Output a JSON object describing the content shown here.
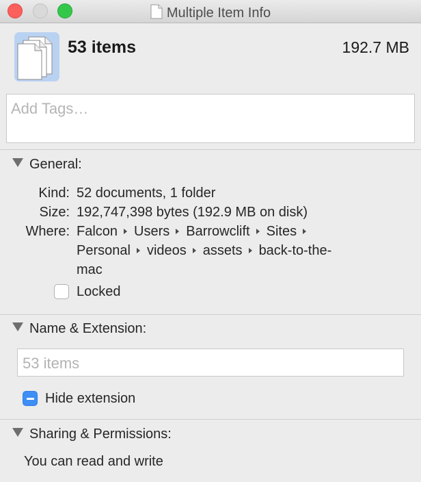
{
  "window": {
    "title": "Multiple Item Info"
  },
  "header": {
    "item_count": "53 items",
    "total_size": "192.7 MB",
    "icon": "stacked-documents-icon"
  },
  "tags": {
    "placeholder": "Add Tags…"
  },
  "general": {
    "heading": "General:",
    "kind_label": "Kind:",
    "kind_value": "52 documents, 1 folder",
    "size_label": "Size:",
    "size_value": "192,747,398 bytes (192.9 MB on disk)",
    "where_label": "Where:",
    "path": [
      "Falcon",
      "Users",
      "Barrowclift",
      "Sites",
      "Personal",
      "videos",
      "assets",
      "back-to-the-",
      "mac"
    ],
    "locked_label": "Locked",
    "locked_checked": false
  },
  "name_extension": {
    "heading": "Name & Extension:",
    "name_placeholder": "53 items",
    "hide_extension_label": "Hide extension",
    "hide_extension_state": "mixed"
  },
  "sharing": {
    "heading": "Sharing & Permissions:",
    "status": "You can read and write"
  },
  "colors": {
    "checkbox_accent": "#3e8ef6",
    "close": "#fc605c",
    "zoom": "#34c84a"
  }
}
